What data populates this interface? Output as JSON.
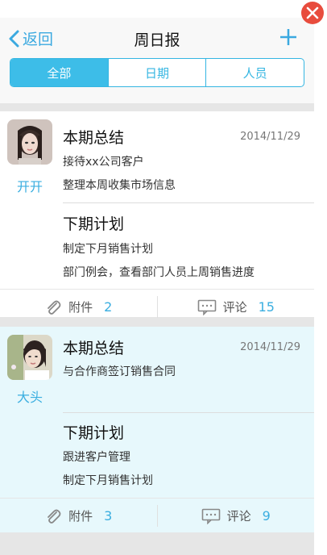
{
  "header": {
    "back_label": "返回",
    "title": "周日报"
  },
  "tabs": [
    {
      "label": "全部",
      "active": true
    },
    {
      "label": "日期",
      "active": false
    },
    {
      "label": "人员",
      "active": false
    }
  ],
  "reports": [
    {
      "user": "开开",
      "summary_title": "本期总结",
      "date": "2014/11/29",
      "summary_lines": [
        "接待xx公司客户",
        "整理本周收集市场信息"
      ],
      "plan_title": "下期计划",
      "plan_lines": [
        "制定下月销售计划",
        "部门例会，查看部门人员上周销售进度"
      ],
      "attach_label": "附件",
      "attach_count": "2",
      "comment_label": "评论",
      "comment_count": "15"
    },
    {
      "user": "大头",
      "summary_title": "本期总结",
      "date": "2014/11/29",
      "summary_lines": [
        "与合作商签订销售合同"
      ],
      "plan_title": "下期计划",
      "plan_lines": [
        "跟进客户管理",
        "制定下月销售计划"
      ],
      "attach_label": "附件",
      "attach_count": "3",
      "comment_label": "评论",
      "comment_count": "9"
    }
  ],
  "colors": {
    "accent": "#3dbde8",
    "highlight_bg": "#e7f8fc",
    "close": "#e84c3d"
  }
}
